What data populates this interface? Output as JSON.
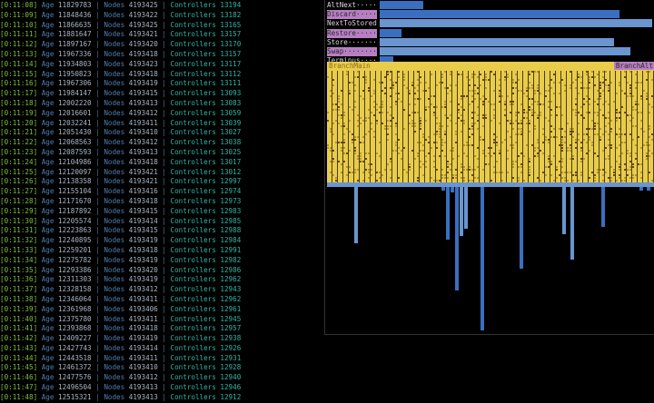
{
  "log": {
    "age_label": "Age",
    "nodes_label": "Nodes",
    "controllers_label": "Controllers",
    "separator": "|",
    "rows": [
      {
        "time": "[0:11:08]",
        "age": "11829783",
        "nodes": "4193425",
        "controllers": "13194"
      },
      {
        "time": "[0:11:09]",
        "age": "11848436",
        "nodes": "4193422",
        "controllers": "13182"
      },
      {
        "time": "[0:11:10]",
        "age": "11866635",
        "nodes": "4193425",
        "controllers": "13165"
      },
      {
        "time": "[0:11:11]",
        "age": "11881647",
        "nodes": "4193421",
        "controllers": "13157"
      },
      {
        "time": "[0:11:12]",
        "age": "11897167",
        "nodes": "4193420",
        "controllers": "13170"
      },
      {
        "time": "[0:11:13]",
        "age": "11967336",
        "nodes": "4193418",
        "controllers": "13157"
      },
      {
        "time": "[0:11:14]",
        "age": "11934803",
        "nodes": "4193423",
        "controllers": "13117"
      },
      {
        "time": "[0:11:15]",
        "age": "11950823",
        "nodes": "4193418",
        "controllers": "13112"
      },
      {
        "time": "[0:11:16]",
        "age": "11967306",
        "nodes": "4193419",
        "controllers": "13111"
      },
      {
        "time": "[0:11:17]",
        "age": "11984147",
        "nodes": "4193415",
        "controllers": "13093"
      },
      {
        "time": "[0:11:18]",
        "age": "12002220",
        "nodes": "4193413",
        "controllers": "13083"
      },
      {
        "time": "[0:11:19]",
        "age": "12016601",
        "nodes": "4193412",
        "controllers": "13059"
      },
      {
        "time": "[0:11:20]",
        "age": "12032241",
        "nodes": "4193411",
        "controllers": "13039"
      },
      {
        "time": "[0:11:21]",
        "age": "12051430",
        "nodes": "4193410",
        "controllers": "13027"
      },
      {
        "time": "[0:11:22]",
        "age": "12068563",
        "nodes": "4193412",
        "controllers": "13038"
      },
      {
        "time": "[0:11:23]",
        "age": "12087593",
        "nodes": "4193413",
        "controllers": "13025"
      },
      {
        "time": "[0:11:24]",
        "age": "12104986",
        "nodes": "4193418",
        "controllers": "13017"
      },
      {
        "time": "[0:11:25]",
        "age": "12120097",
        "nodes": "4193421",
        "controllers": "13012"
      },
      {
        "time": "[0:11:26]",
        "age": "12138358",
        "nodes": "4193421",
        "controllers": "12997"
      },
      {
        "time": "[0:11:27]",
        "age": "12155104",
        "nodes": "4193416",
        "controllers": "12974"
      },
      {
        "time": "[0:11:28]",
        "age": "12171670",
        "nodes": "4193418",
        "controllers": "12973"
      },
      {
        "time": "[0:11:29]",
        "age": "12187892",
        "nodes": "4193415",
        "controllers": "12983"
      },
      {
        "time": "[0:11:30]",
        "age": "12205574",
        "nodes": "4193414",
        "controllers": "12985"
      },
      {
        "time": "[0:11:31]",
        "age": "12223863",
        "nodes": "4193415",
        "controllers": "12988"
      },
      {
        "time": "[0:11:32]",
        "age": "12240895",
        "nodes": "4193419",
        "controllers": "12984"
      },
      {
        "time": "[0:11:33]",
        "age": "12259201",
        "nodes": "4193418",
        "controllers": "12991"
      },
      {
        "time": "[0:11:34]",
        "age": "12275782",
        "nodes": "4193419",
        "controllers": "12982"
      },
      {
        "time": "[0:11:35]",
        "age": "12293386",
        "nodes": "4193420",
        "controllers": "12986"
      },
      {
        "time": "[0:11:36]",
        "age": "12311303",
        "nodes": "4193419",
        "controllers": "12962"
      },
      {
        "time": "[0:11:37]",
        "age": "12328158",
        "nodes": "4193412",
        "controllers": "12943"
      },
      {
        "time": "[0:11:38]",
        "age": "12346064",
        "nodes": "4193411",
        "controllers": "12962"
      },
      {
        "time": "[0:11:39]",
        "age": "12361968",
        "nodes": "4193406",
        "controllers": "12961"
      },
      {
        "time": "[0:11:40]",
        "age": "12375780",
        "nodes": "4193411",
        "controllers": "12945"
      },
      {
        "time": "[0:11:41]",
        "age": "12393868",
        "nodes": "4193418",
        "controllers": "12957"
      },
      {
        "time": "[0:11:42]",
        "age": "12409227",
        "nodes": "4193419",
        "controllers": "12938"
      },
      {
        "time": "[0:11:43]",
        "age": "12427743",
        "nodes": "4193414",
        "controllers": "12926"
      },
      {
        "time": "[0:11:44]",
        "age": "12443518",
        "nodes": "4193411",
        "controllers": "12931"
      },
      {
        "time": "[0:11:45]",
        "age": "12461372",
        "nodes": "4193410",
        "controllers": "12928"
      },
      {
        "time": "[0:11:46]",
        "age": "12477576",
        "nodes": "4193412",
        "controllers": "12940"
      },
      {
        "time": "[0:11:47]",
        "age": "12496504",
        "nodes": "4193413",
        "controllers": "12946"
      },
      {
        "time": "[0:11:48]",
        "age": "12515321",
        "nodes": "4193413",
        "controllers": "12912"
      }
    ]
  },
  "instructions": {
    "items": [
      {
        "label": "AltNext·····",
        "share": 0.16,
        "highlighted": false
      },
      {
        "label": "Discard·····",
        "share": 0.88,
        "highlighted": true
      },
      {
        "label": "NextToStored",
        "share": 1.0,
        "highlighted": false
      },
      {
        "label": "Restore·····",
        "share": 0.08,
        "highlighted": true
      },
      {
        "label": "Store·······",
        "share": 0.86,
        "highlighted": false
      },
      {
        "label": "Swap········",
        "share": 0.92,
        "highlighted": true
      },
      {
        "label": "Terminus····",
        "share": 0.05,
        "highlighted": false
      }
    ]
  },
  "branch": {
    "left_label": "BranchMain",
    "right_label": "BranchAlt"
  },
  "colors": {
    "timestamp": "#7fbf3f",
    "label": "#4f7faf",
    "controllers": "#2fb6a6",
    "bar_blue": "#3a6fc0",
    "bar_light": "#6a95cf",
    "highlight": "#b77fc2",
    "branch_yellow": "#e9cc4a"
  }
}
